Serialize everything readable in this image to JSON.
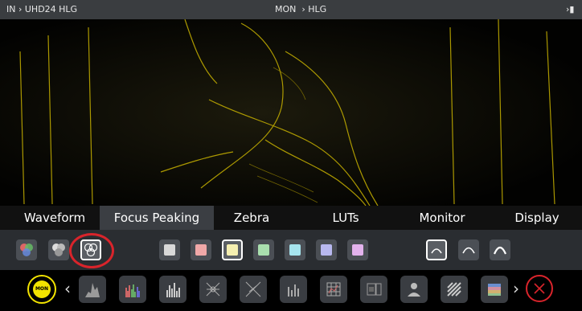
{
  "topbar": {
    "input": "IN  ›  UHD24 HLG",
    "monitor_label": "MON",
    "monitor_value": "›  HLG",
    "right_glyph": "›"
  },
  "tabs": [
    "Waveform",
    "Focus Peaking",
    "Zebra",
    "LUTs",
    "Monitor",
    "Display"
  ],
  "active_tab": "Focus Peaking",
  "colors": {
    "accent": "#d9242b",
    "mon_yellow": "#f2e300",
    "peaking": "#c8b200"
  },
  "peaking_colors": [
    "#d8d8d8",
    "#f0a8a8",
    "#f5efb0",
    "#a9dfae",
    "#a6e4ee",
    "#b8b8ef",
    "#e3b2ec"
  ],
  "selected_color_index": 2,
  "bottom": {
    "mon_button": "MON"
  }
}
